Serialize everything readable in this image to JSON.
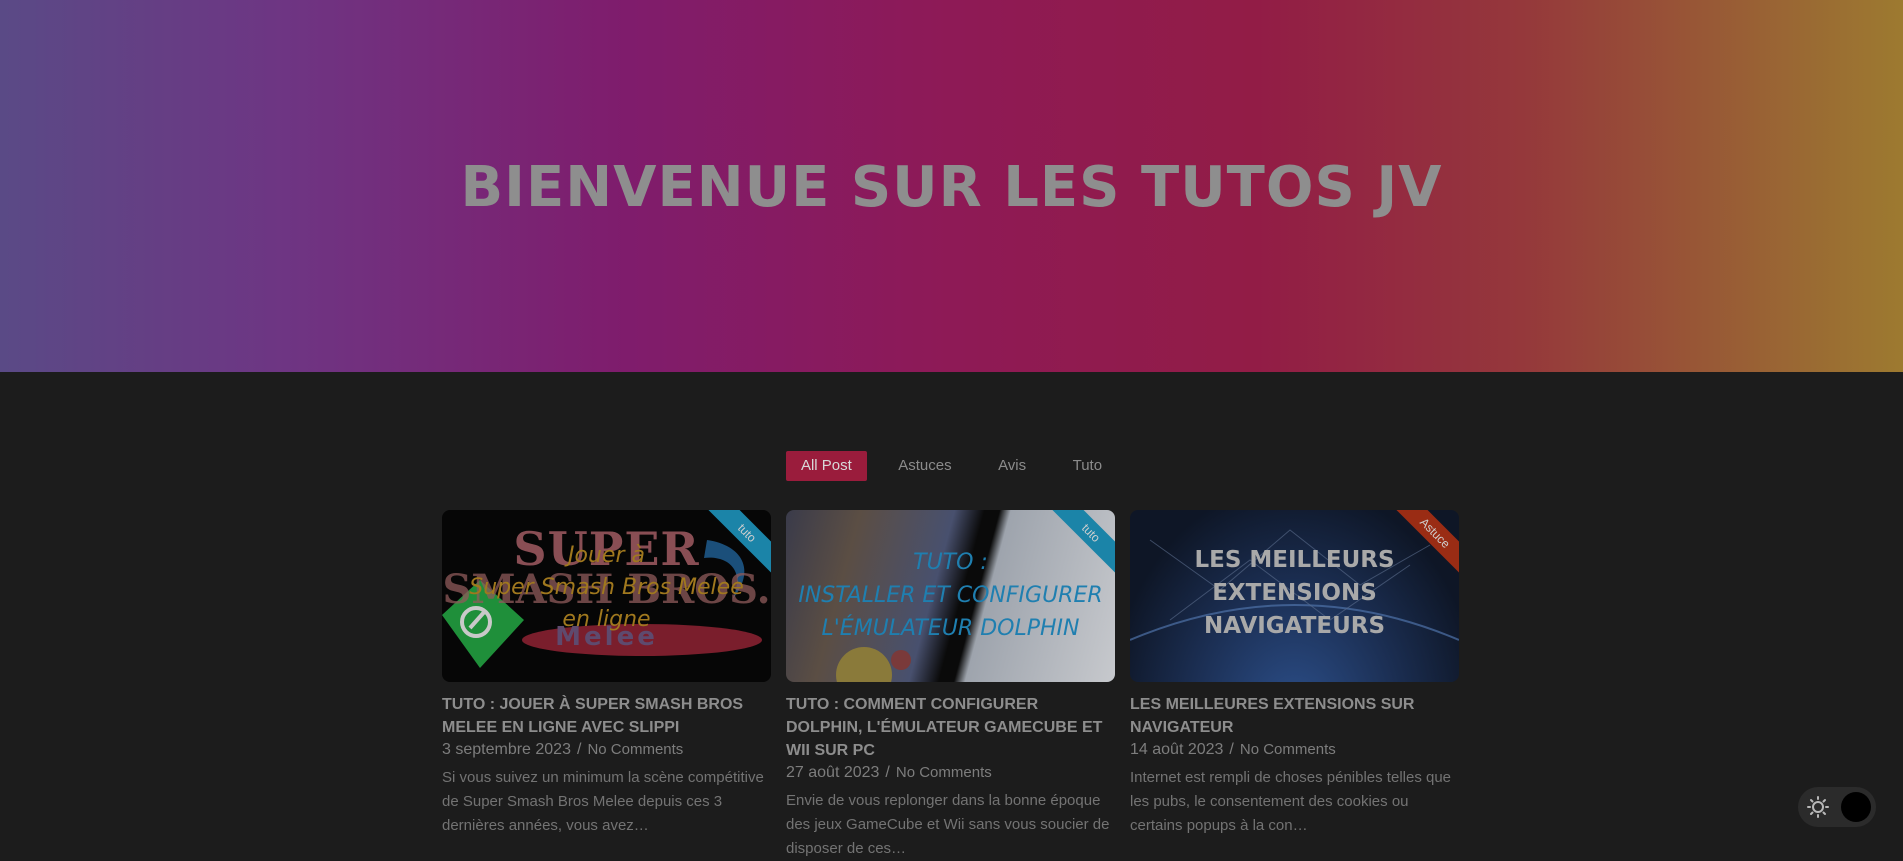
{
  "hero": {
    "title": "BIENVENUE SUR LES TUTOS JV"
  },
  "filters": [
    "All Post",
    "Astuces",
    "Avis",
    "Tuto"
  ],
  "posts": [
    {
      "ribbon": "tuto",
      "ribbon_color": "#1b84a8",
      "thumb_lines": [
        "Jouer à",
        "Super Smash Bros Melee",
        "en ligne"
      ],
      "thumb_logo_lines": [
        "SUPER",
        "SMASH BROS.",
        "Melee"
      ],
      "title": "TUTO : JOUER À SUPER SMASH BROS MELEE EN LIGNE AVEC SLIPPI",
      "date": "3 septembre 2023",
      "comments": "No Comments",
      "excerpt": "Si vous suivez un minimum la scène compétitive de Super Smash Bros Melee depuis ces 3 dernières années, vous avez…"
    },
    {
      "ribbon": "tuto",
      "ribbon_color": "#1b84a8",
      "thumb_lines": [
        "TUTO :",
        "INSTALLER ET CONFIGURER",
        "L'ÉMULATEUR DOLPHIN"
      ],
      "title": "TUTO : COMMENT CONFIGURER DOLPHIN, L'ÉMULATEUR GAMECUBE ET WII SUR PC",
      "date": "27 août 2023",
      "comments": "No Comments",
      "excerpt": "Envie de vous replonger dans la bonne époque des jeux GameCube et Wii sans vous soucier de disposer de ces…"
    },
    {
      "ribbon": "Astuce",
      "ribbon_color": "#9a2c14",
      "thumb_lines": [
        "LES MEILLEURS",
        "EXTENSIONS",
        "NAVIGATEURS"
      ],
      "title": "LES MEILLEURES EXTENSIONS SUR NAVIGATEUR",
      "date": "14 août 2023",
      "comments": "No Comments",
      "excerpt": "Internet est rempli de choses pénibles telles que les pubs, le consentement des cookies ou certains popups à la con…"
    }
  ],
  "meta_separator": "/"
}
